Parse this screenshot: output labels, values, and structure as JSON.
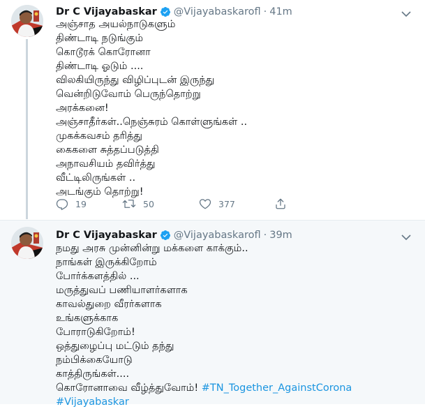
{
  "tweets": [
    {
      "author": {
        "name": "Dr C Vijayabaskar",
        "handle": "@Vijayabaskarofl"
      },
      "time": "41m",
      "lines": [
        "அஞ்சாத அயல்நாடுகளும்",
        "திண்டாடி நடுங்கும்",
        "கொடூரக் கொரோனா",
        "திண்டாடி ஓடும் ....",
        "விலகியிருந்து விழிப்புடன் இருந்து",
        "வென்றிடுவோம் பெருந்தொற்று",
        "அரக்கனை!",
        "அஞ்சாதீர்கள்..நெஞ்சுரம் கொள்ளுங்கள் ..",
        "முகக்கவசம் தரித்து",
        "கைகளை சுத்தப்படுத்தி",
        "அநாவசியம் தவிர்த்து",
        "வீட்டிலிருங்கள் ..",
        "அடங்கும் தொற்று!"
      ],
      "stats": {
        "replies": "19",
        "retweets": "50",
        "likes": "377"
      }
    },
    {
      "author": {
        "name": "Dr C Vijayabaskar",
        "handle": "@Vijayabaskarofl"
      },
      "time": "39m",
      "lines": [
        "நமது அரசு முன்னின்று மக்களை காக்கும்..",
        "நாங்கள் இருக்கிறோம்",
        "போர்க்களத்தில் ...",
        "மருத்துவப் பணியாளர்களாக",
        "காவல்துறை வீரர்களாக",
        "உங்களுக்காக",
        "போராடுகிறோம்!",
        "ஒத்துழைப்பு மட்டும் தந்து",
        "நம்பிக்கையோடு",
        "காத்திருங்கள்....",
        "கொரோனாவை வீழ்த்துவோம்!"
      ],
      "hashtags": [
        "#TN_Together_AgainstCorona",
        "#Vijayabaskar"
      ]
    }
  ],
  "colors": {
    "accent": "#1b95e0",
    "verified": "#1da1f2",
    "muted": "#657786",
    "text": "#14171a"
  },
  "icons": [
    "verified-badge-icon",
    "chevron-down-icon",
    "reply-icon",
    "retweet-icon",
    "like-icon",
    "share-icon"
  ]
}
